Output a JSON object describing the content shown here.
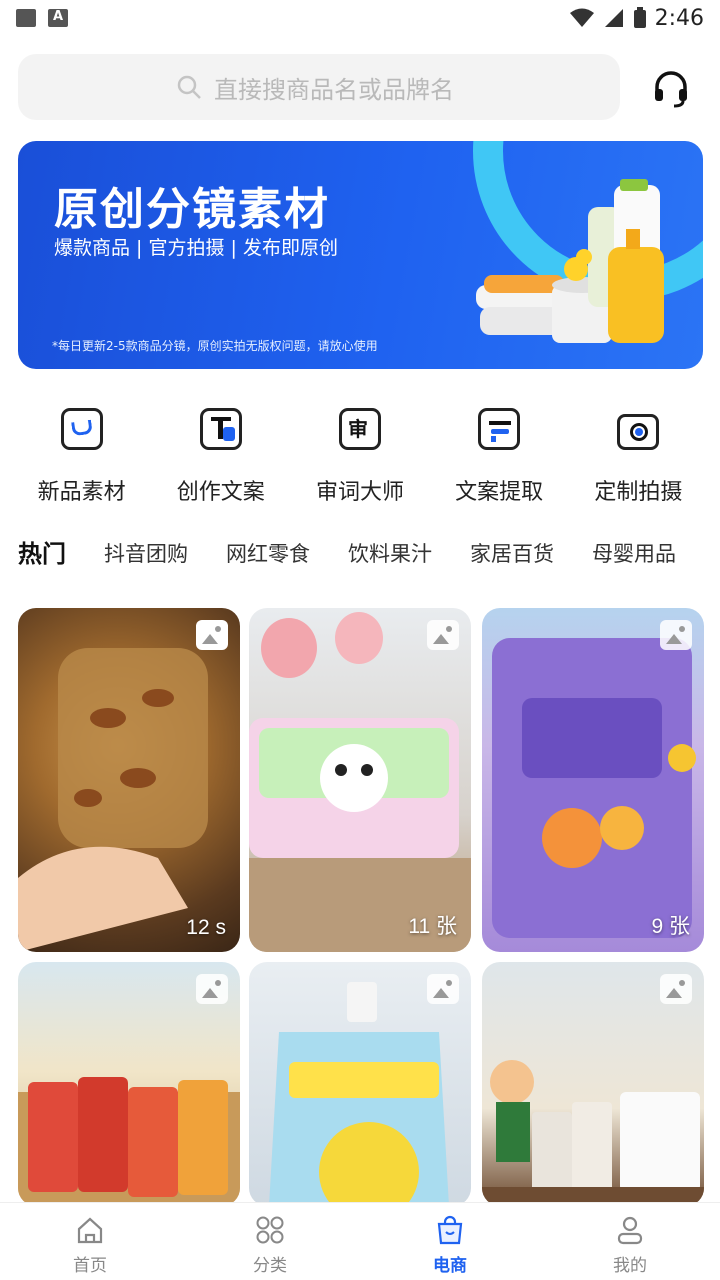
{
  "status": {
    "time": "2:46"
  },
  "search": {
    "placeholder": "直接搜商品名或品牌名"
  },
  "banner": {
    "title": "原创分镜素材",
    "subtitle": "爆款商品 | 官方拍摄 | 发布即原创",
    "note": "*每日更新2-5款商品分镜，原创实拍无版权问题，请放心使用"
  },
  "quick": [
    {
      "label": "新品素材",
      "icon": "bag-icon"
    },
    {
      "label": "创作文案",
      "icon": "text-icon"
    },
    {
      "label": "审词大师",
      "icon": "review-icon"
    },
    {
      "label": "文案提取",
      "icon": "extract-icon"
    },
    {
      "label": "定制拍摄",
      "icon": "camera-icon"
    }
  ],
  "tabs": [
    "热门",
    "抖音团购",
    "网红零食",
    "饮料果汁",
    "家居百货",
    "母婴用品"
  ],
  "cards": [
    {
      "count": "12 s",
      "type": "video"
    },
    {
      "count": "11 张",
      "type": "image"
    },
    {
      "count": "9 张",
      "type": "image"
    },
    {
      "count": "",
      "type": "image"
    },
    {
      "count": "",
      "type": "image"
    },
    {
      "count": "",
      "type": "image"
    }
  ],
  "nav": [
    {
      "label": "首页",
      "icon": "home-icon"
    },
    {
      "label": "分类",
      "icon": "grid-icon"
    },
    {
      "label": "电商",
      "icon": "shop-bag-icon",
      "active": true
    },
    {
      "label": "我的",
      "icon": "user-icon"
    }
  ],
  "colors": {
    "accent": "#1f62f0",
    "banner_ring": "#40c7f5"
  }
}
